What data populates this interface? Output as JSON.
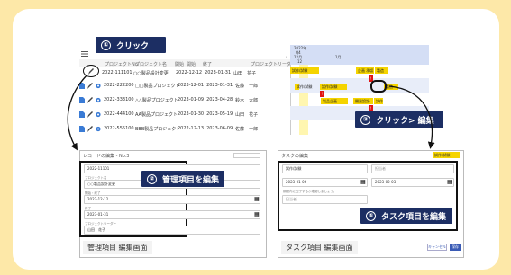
{
  "callouts": {
    "click": {
      "num": "①",
      "text": "クリック"
    },
    "edit_manage": {
      "num": "②",
      "text": "管理項目を編集"
    },
    "click_edit": {
      "num": "③",
      "text": "クリック> 編集"
    },
    "edit_task": {
      "num": "④",
      "text": "タスク項目を編集"
    }
  },
  "table": {
    "headers": [
      "プロジェクトNo.",
      "プロジェクト名",
      "開始",
      "開始",
      "終了",
      "プロジェクトリーダー"
    ],
    "rows": [
      {
        "no": "2022-111101",
        "name": "○○製品設計変更",
        "start": "2022-12-12",
        "end": "2023-01-31",
        "leader": "山田　花子"
      },
      {
        "no": "2022-222200",
        "name": "□□製品プロジェクト",
        "start": "2023-12-01",
        "end": "2023-01-31",
        "leader": "佐藤　一郎"
      },
      {
        "no": "2022-333100",
        "name": "△△製品プロジェクト",
        "start": "2023-01-09",
        "end": "2023-04-28",
        "leader": "鈴木　太郎"
      },
      {
        "no": "2022-444100",
        "name": "AA製品プロジェクト",
        "start": "2023-01-30",
        "end": "2023-05-19",
        "leader": "山田　花子"
      },
      {
        "no": "2022-555100",
        "name": "BBB製品プロジェクト",
        "start": "2022-12-13",
        "end": "2023-06-09",
        "leader": "佐藤　一郎"
      }
    ]
  },
  "gantt": {
    "year": "2022年",
    "quarter": "Q4",
    "month_a": "12月",
    "month_b": "1月",
    "col": "12",
    "bars": [
      {
        "label": "試作/試験"
      },
      {
        "label": "企画 承認"
      },
      {
        "label": "製造"
      },
      {
        "label": "試作/試験"
      },
      {
        "label": "試作/試験"
      },
      {
        "label": "製造"
      },
      {
        "label": "製品企画"
      },
      {
        "label": "開発設計"
      },
      {
        "label": "試作"
      }
    ],
    "flags": [
      "!",
      "!",
      "!"
    ]
  },
  "left_form": {
    "title": "レコードの編集 - No.3",
    "fields": [
      {
        "label": "",
        "value": "2022-11101"
      },
      {
        "label": "プロジェクト名",
        "value": "○○製品設計変更"
      },
      {
        "label": "開始・終了",
        "value": "2022-12-12"
      },
      {
        "label": "終了",
        "value": "2023-01-31"
      },
      {
        "label": "プロジェクトリーダー",
        "value": "山田　花子"
      }
    ],
    "caption": "管理項目 編集画面"
  },
  "right_form": {
    "title": "タスクの編集",
    "tag": "試作/試験",
    "fields": [
      {
        "label": "",
        "value": "試作/試験"
      },
      {
        "label": "",
        "value": "担当者"
      },
      {
        "label": "",
        "value": "2023-01-06"
      },
      {
        "label": "",
        "value": "2023-02-03"
      },
      {
        "label": "",
        "value": "期間内に完了するか確認しましょう。"
      },
      {
        "label": "",
        "value": "担当者"
      }
    ],
    "caption": "タスク項目 編集画面",
    "cancel": "キャンセル",
    "save": "保存"
  },
  "colors": {
    "navy": "#1c2e63",
    "bg": "#fde8a8",
    "yellow": "#f5d400",
    "red": "#e01414",
    "ganttblue": "#d4def5"
  },
  "icons": [
    "hamburger-icon",
    "doc-icon",
    "pencil-icon",
    "gear-icon",
    "chevron-left-icon",
    "calendar-icon",
    "arrow-icon"
  ]
}
